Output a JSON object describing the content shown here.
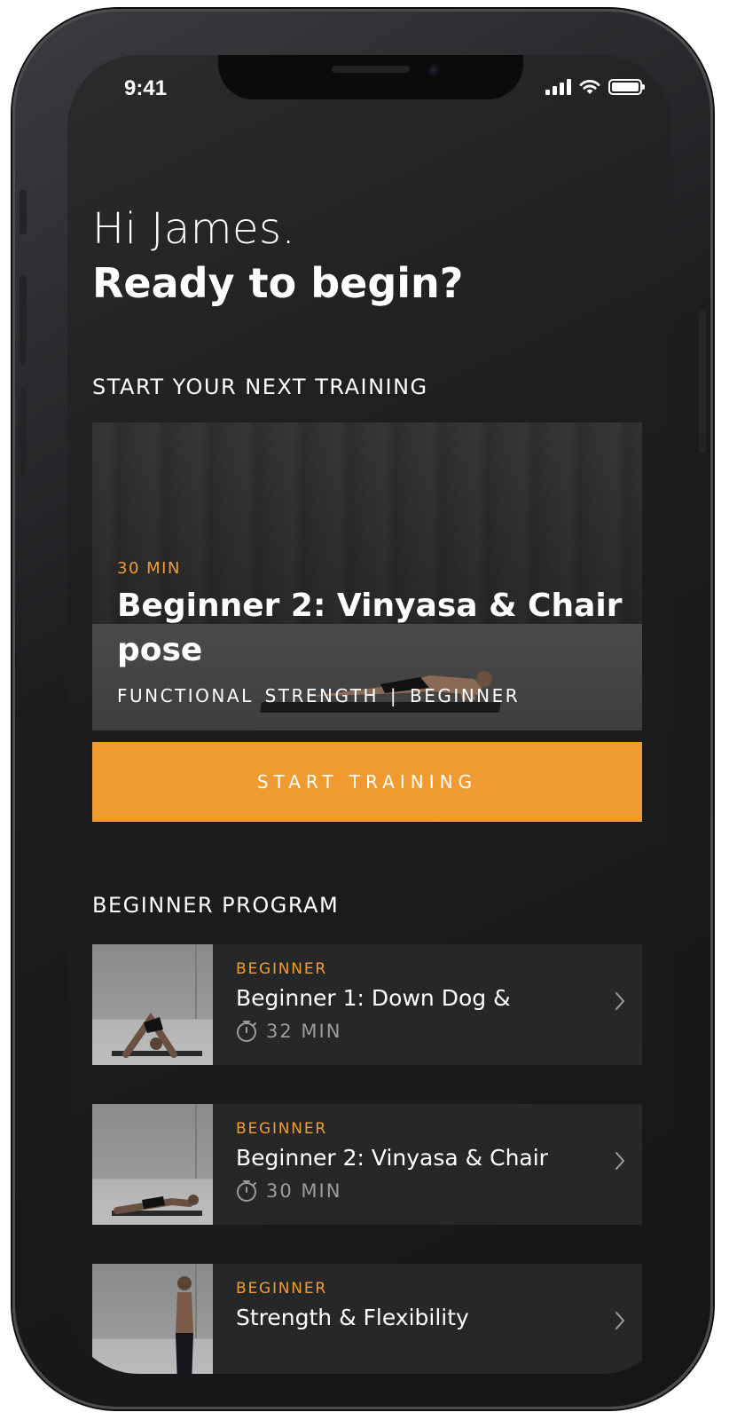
{
  "status_bar": {
    "time": "9:41"
  },
  "greeting": {
    "line1": "Hi James.",
    "line2": "Ready to begin?"
  },
  "next_training": {
    "section_title": "START YOUR NEXT TRAINING",
    "duration": "30 MIN",
    "title": "Beginner 2: Vinyasa & Chair pose",
    "meta": "FUNCTIONAL STRENGTH  |  BEGINNER",
    "button_label": "START TRAINING"
  },
  "program": {
    "section_title": "BEGINNER PROGRAM",
    "items": [
      {
        "level": "BEGINNER",
        "title": "Beginner 1: Down Dog &",
        "duration": "32 MIN"
      },
      {
        "level": "BEGINNER",
        "title": "Beginner 2: Vinyasa & Chair",
        "duration": "30 MIN"
      },
      {
        "level": "BEGINNER",
        "title": "Strength & Flexibility",
        "duration": ""
      }
    ]
  },
  "colors": {
    "accent": "#f09b31",
    "background": "#1d1e20",
    "card": "#262729"
  },
  "icons": [
    "signal-icon",
    "wifi-icon",
    "battery-icon",
    "stopwatch-icon",
    "chevron-right-icon"
  ]
}
